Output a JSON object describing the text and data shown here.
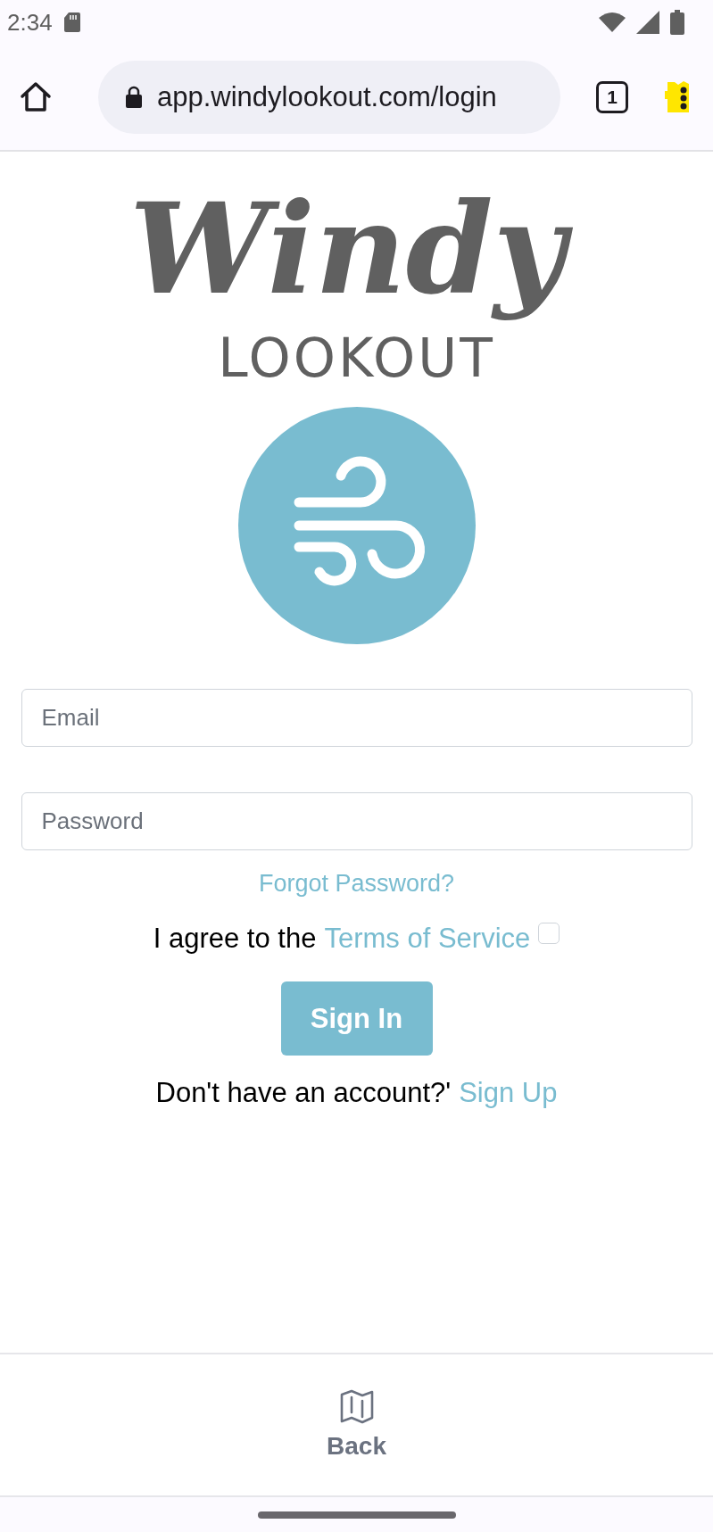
{
  "status_bar": {
    "time": "2:34"
  },
  "browser": {
    "url": "app.windylookout.com/login",
    "tab_count": "1"
  },
  "logo": {
    "title": "Windy",
    "subtitle": "LOOKOUT"
  },
  "form": {
    "email": {
      "placeholder": "Email"
    },
    "password": {
      "placeholder": "Password"
    },
    "forgot_link": "Forgot Password?",
    "agree": {
      "text": "I agree to the",
      "link": "Terms of Service",
      "checked": false
    },
    "sign_in": "Sign In",
    "signup": {
      "text": "Don't have an account?'",
      "link": "Sign Up"
    }
  },
  "bottom_nav": [
    {
      "label": "Back"
    }
  ]
}
